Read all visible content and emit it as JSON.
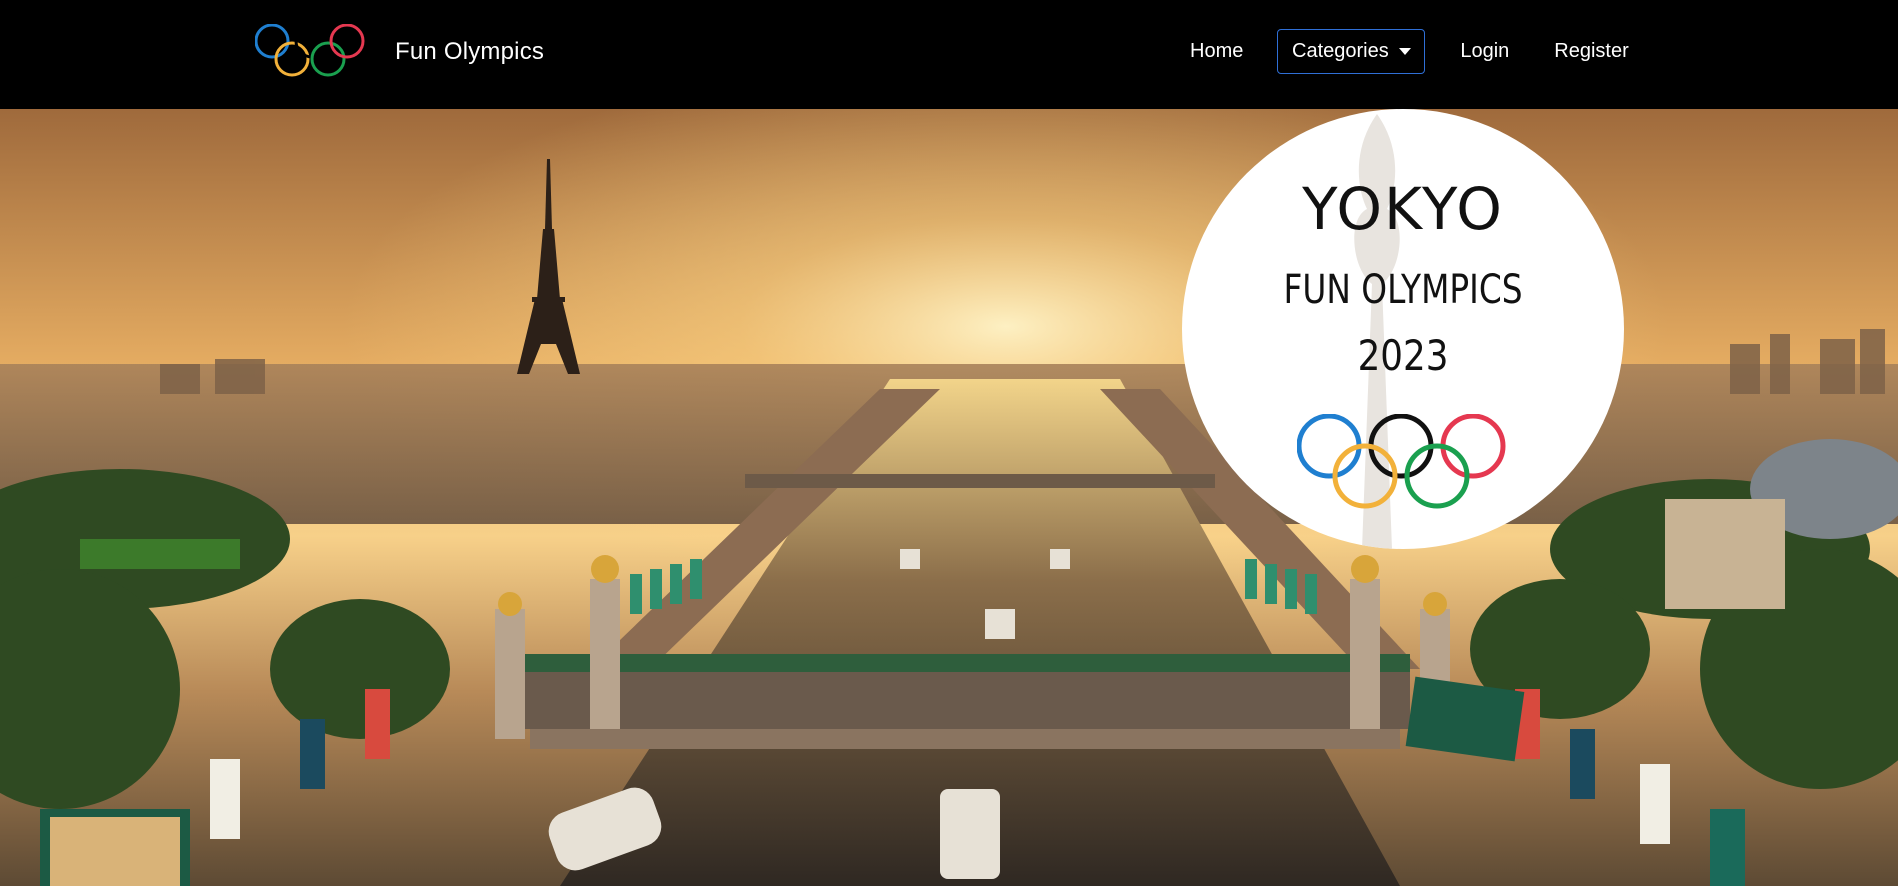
{
  "nav": {
    "brand_name": "Fun Olympics",
    "links": {
      "home": "Home",
      "categories": "Categories",
      "login": "Login",
      "register": "Register"
    }
  },
  "hero": {
    "badge": {
      "line1": "YOKYO",
      "line2": "FUN OLYMPICS",
      "line3": "2023"
    }
  },
  "colors": {
    "navbar_bg": "#000000",
    "ring_blue": "#1f7fd0",
    "ring_yellow": "#f2b13a",
    "ring_black": "#111111",
    "ring_green": "#1aa04f",
    "ring_red": "#e53850",
    "categories_border": "#2f6fd6"
  }
}
